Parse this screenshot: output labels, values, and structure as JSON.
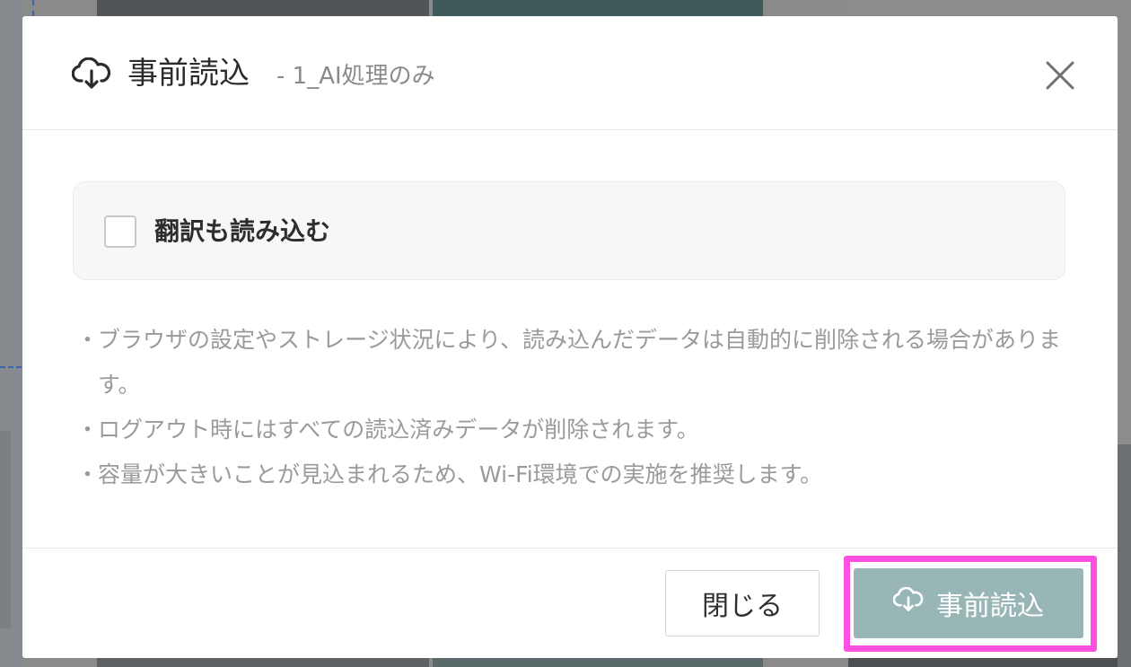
{
  "dialog": {
    "title": "事前読込",
    "subtitle": "- 1_AI処理のみ",
    "header_icon": "cloud-download-icon",
    "close_icon": "close-icon"
  },
  "option": {
    "checkbox_label": "翻訳も読み込む",
    "checked": false
  },
  "notes": [
    "ブラウザの設定やストレージ状況により、読み込んだデータは自動的に削除される場合があります。",
    "ログアウト時にはすべての読込済みデータが削除されます。",
    "容量が大きいことが見込まれるため、Wi-Fi環境での実施を推奨します。"
  ],
  "note_bullet": "・",
  "footer": {
    "close_label": "閉じる",
    "preload_label": "事前読込",
    "preload_icon": "cloud-download-icon"
  },
  "colors": {
    "preload_button": "#99b6b6",
    "highlight_frame": "#ff4fe0"
  }
}
